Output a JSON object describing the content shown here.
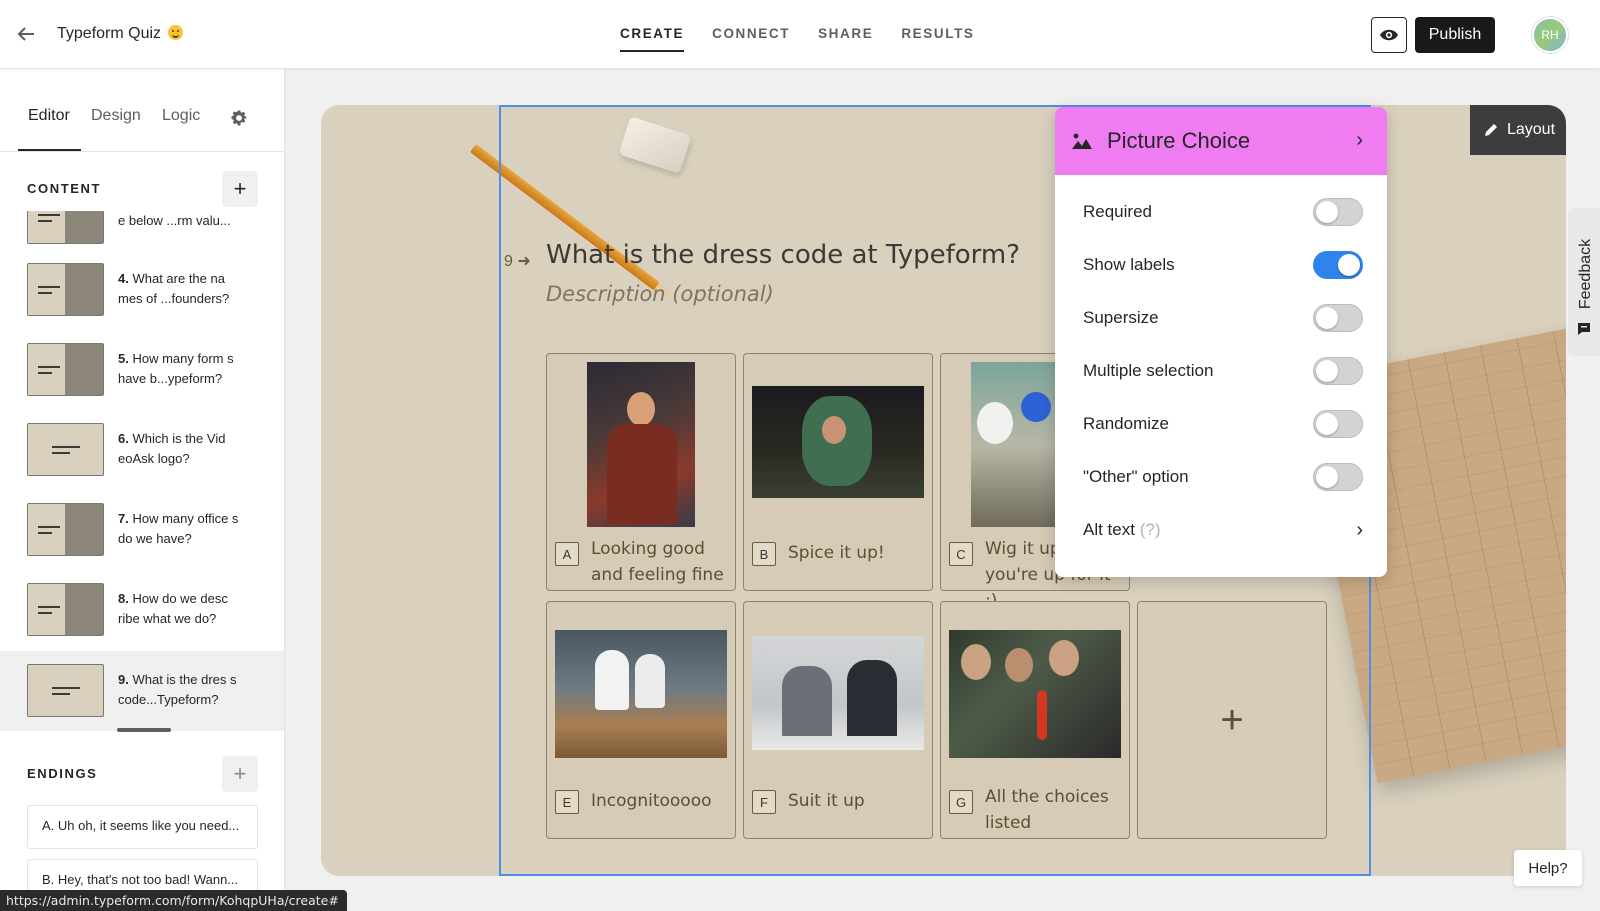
{
  "header": {
    "form_title": "Typeform Quiz",
    "tabs": [
      "CREATE",
      "CONNECT",
      "SHARE",
      "RESULTS"
    ],
    "active_tab": "CREATE",
    "publish_label": "Publish",
    "avatar_initials": "RH"
  },
  "sidebar": {
    "tabs": [
      "Editor",
      "Design",
      "Logic"
    ],
    "active_tab": "Editor",
    "content_label": "CONTENT",
    "add_symbol": "+",
    "questions": [
      {
        "num": "",
        "text": "e below ...rm valu..."
      },
      {
        "num": "4.",
        "text": "What are the na mes of ...founders?"
      },
      {
        "num": "5.",
        "text": "How many form s have b...ypeform?"
      },
      {
        "num": "6.",
        "text": "Which is the Vid eoAsk logo?"
      },
      {
        "num": "7.",
        "text": "How many office s do we have?"
      },
      {
        "num": "8.",
        "text": "How do we desc ribe what we do?"
      },
      {
        "num": "9.",
        "text": "What is the dres s code...Typeform?"
      }
    ],
    "endings_label": "ENDINGS",
    "endings": [
      "A. Uh oh, it seems like you need...",
      "B. Hey, that's not too bad! Wann..."
    ]
  },
  "status_url": "https://admin.typeform.com/form/KohqpUHa/create#",
  "canvas": {
    "layout_label": "Layout",
    "question_number": "9",
    "question_title": "What is the dress code at Typeform?",
    "question_description": "Description (optional)",
    "choices": [
      {
        "key": "A",
        "label": "Looking good and feeling fine"
      },
      {
        "key": "B",
        "label": "Spice it up!"
      },
      {
        "key": "C",
        "label": "Wig it up if you're up for it :)"
      },
      {
        "key": "E",
        "label": "Incognitooooo"
      },
      {
        "key": "F",
        "label": "Suit it up"
      },
      {
        "key": "G",
        "label": "All the choices listed"
      }
    ],
    "add_choice_symbol": "+"
  },
  "settings_panel": {
    "title": "Picture Choice",
    "options": [
      {
        "label": "Required",
        "on": false
      },
      {
        "label": "Show labels",
        "on": true
      },
      {
        "label": "Supersize",
        "on": false
      },
      {
        "label": "Multiple selection",
        "on": false
      },
      {
        "label": "Randomize",
        "on": false
      },
      {
        "label": "\"Other\" option",
        "on": false
      }
    ],
    "alt_text_label": "Alt text",
    "alt_text_hint": "(?)"
  },
  "feedback_label": "Feedback",
  "help_label": "Help?",
  "colors": {
    "accent_blue": "#2f84eb",
    "picture_choice_pink": "#ef7cf1",
    "canvas_background": "#d9d0bd",
    "publish_black": "#191919"
  },
  "icons": [
    "back-arrow-icon",
    "eye-icon",
    "gear-icon",
    "image-icon",
    "chevron-right-icon",
    "pencil-icon",
    "feedback-icon",
    "plus-icon"
  ]
}
